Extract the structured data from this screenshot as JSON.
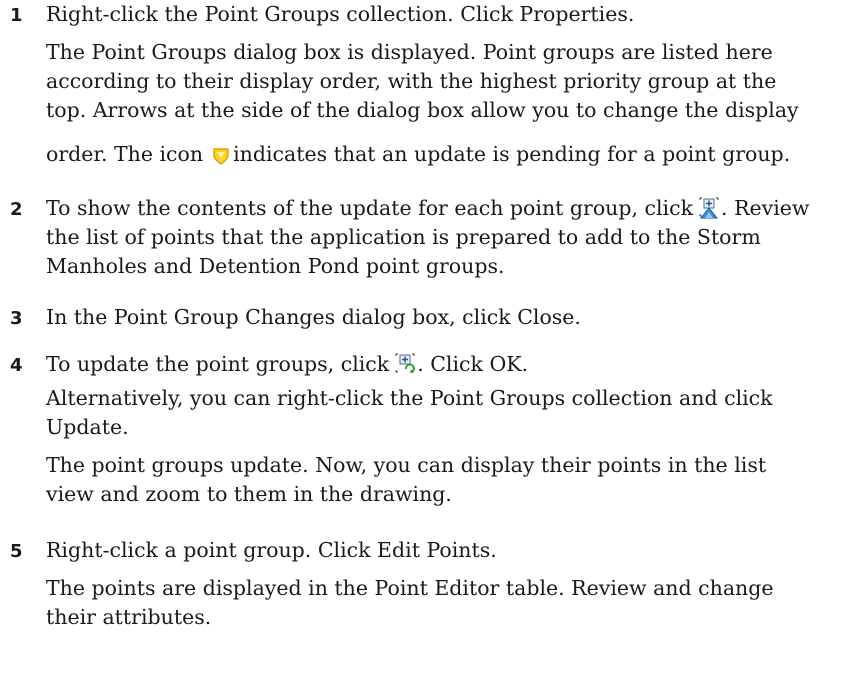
{
  "icons": {
    "pending_update": "yellow-shield-update-pending-icon",
    "show_changes": "point-group-changes-icon",
    "update_groups": "update-point-groups-icon"
  },
  "steps": [
    {
      "number": "1",
      "action": "Right-click the Point Groups collection. Click Properties.",
      "result_lines": [
        "The Point Groups dialog box is displayed. Point groups are listed here",
        "according to their display order, with the highest priority group at the",
        "top. Arrows at the side of the dialog box allow you to change the display"
      ],
      "result_last_before_icon": "order. The icon",
      "result_last_after_icon": "indicates that an update is pending for a point group."
    },
    {
      "number": "2",
      "action_before_icon": "To show the contents of the update for each point group, click",
      "action_after_icon": ". Review",
      "action_lines": [
        "the list of points that the application is prepared to add to the Storm",
        "Manholes and Detention Pond point groups."
      ]
    },
    {
      "number": "3",
      "action": "In the Point Group Changes dialog box, click Close."
    },
    {
      "number": "4",
      "action_before_icon": "To update the point groups, click",
      "action_after_icon": ". Click OK.",
      "alt_lines": [
        "Alternatively, you can right-click the Point Groups collection and click",
        "Update."
      ],
      "result_lines": [
        "The point groups update. Now, you can display their points in the list",
        "view and zoom to them in the drawing."
      ]
    },
    {
      "number": "5",
      "action": "Right-click a point group. Click Edit Points.",
      "result_lines": [
        "The points are displayed in the Point Editor table. Review and change",
        "their attributes."
      ]
    }
  ]
}
